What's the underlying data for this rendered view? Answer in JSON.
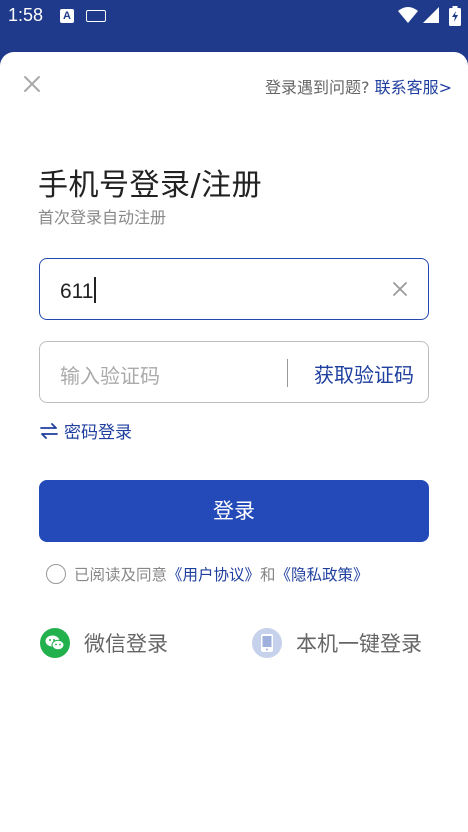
{
  "status_bar": {
    "time": "1:58",
    "a_badge": "A"
  },
  "header": {
    "help_text": "登录遇到问题?",
    "contact_link": "联系客服>"
  },
  "title": "手机号登录/注册",
  "subtitle": "首次登录自动注册",
  "phone": {
    "value": "611"
  },
  "code": {
    "placeholder": "输入验证码",
    "get_code_label": "获取验证码"
  },
  "password_login_label": "密码登录",
  "login_button_label": "登录",
  "agreement": {
    "prefix": "已阅读及同意",
    "user_agreement": "《用户协议》",
    "conj": "和",
    "privacy_policy": "《隐私政策》"
  },
  "alt_logins": {
    "wechat_label": "微信登录",
    "onekey_label": "本机一键登录"
  },
  "colors": {
    "brand": "#1f3a8a",
    "accent": "#2449b8",
    "link": "#1f3f9f",
    "wechat": "#22b14c"
  }
}
